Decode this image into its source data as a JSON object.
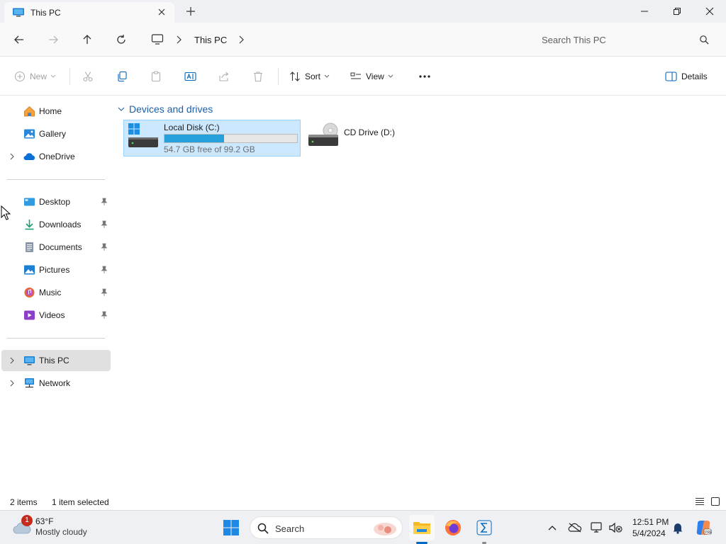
{
  "window": {
    "tab_title": "This PC",
    "new_tab": "+"
  },
  "address": {
    "breadcrumb": [
      "This PC"
    ],
    "search_placeholder": "Search This PC"
  },
  "toolbar": {
    "new_label": "New",
    "sort_label": "Sort",
    "view_label": "View",
    "details_label": "Details"
  },
  "sidebar": {
    "top": [
      {
        "label": "Home",
        "icon": "home-icon"
      },
      {
        "label": "Gallery",
        "icon": "gallery-icon"
      },
      {
        "label": "OneDrive",
        "icon": "onedrive-icon"
      }
    ],
    "pinned": [
      {
        "label": "Desktop",
        "icon": "desktop-icon"
      },
      {
        "label": "Downloads",
        "icon": "downloads-icon"
      },
      {
        "label": "Documents",
        "icon": "documents-icon"
      },
      {
        "label": "Pictures",
        "icon": "pictures-icon"
      },
      {
        "label": "Music",
        "icon": "music-icon"
      },
      {
        "label": "Videos",
        "icon": "videos-icon"
      }
    ],
    "bottom": [
      {
        "label": "This PC",
        "icon": "this-pc-icon",
        "selected": true
      },
      {
        "label": "Network",
        "icon": "network-icon"
      }
    ]
  },
  "content": {
    "group_title": "Devices and drives",
    "drives": [
      {
        "name": "Local Disk (C:)",
        "free_text": "54.7 GB free of 99.2 GB",
        "used_fraction": 0.449,
        "selected": true
      },
      {
        "name": "CD Drive (D:)"
      }
    ]
  },
  "status": {
    "item_count": "2 items",
    "selection": "1 item selected"
  },
  "taskbar": {
    "weather_temp": "63°F",
    "weather_desc": "Mostly cloudy",
    "weather_badge": "1",
    "search_label": "Search",
    "time": "12:51 PM",
    "date": "5/4/2024"
  },
  "colors": {
    "accent": "#0067c0",
    "selection": "#cce8ff",
    "drive_bar": "#26a0da",
    "group_header": "#1d5fa8"
  }
}
